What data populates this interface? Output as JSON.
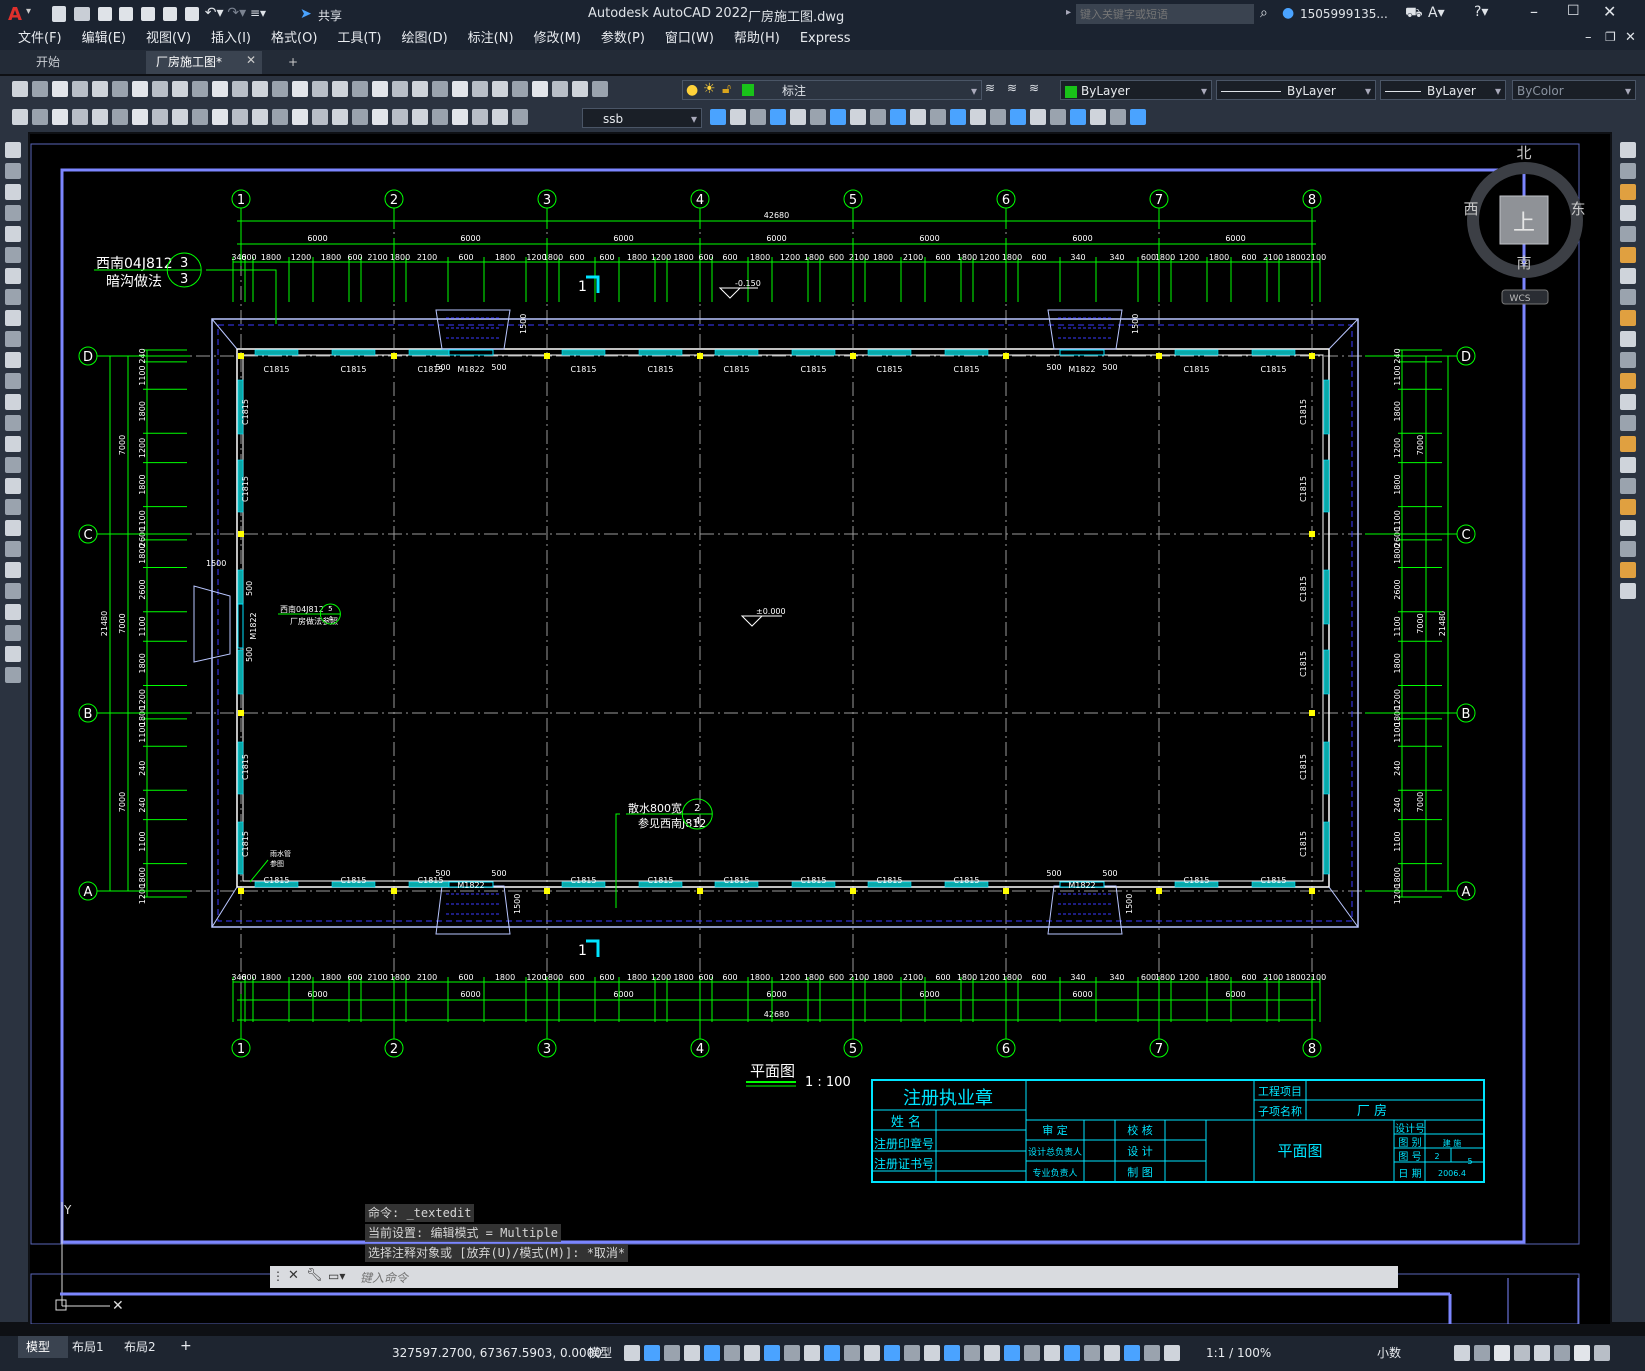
{
  "app": {
    "title": "Autodesk AutoCAD 2022",
    "filename": "厂房施工图.dwg",
    "share_label": "共享",
    "search_placeholder": "键入关键字或短语",
    "user": "1505999135...",
    "logo": "A"
  },
  "menu": [
    "文件(F)",
    "编辑(E)",
    "视图(V)",
    "插入(I)",
    "格式(O)",
    "工具(T)",
    "绘图(D)",
    "标注(N)",
    "修改(M)",
    "参数(P)",
    "窗口(W)",
    "帮助(H)",
    "Express"
  ],
  "tabs": {
    "start": "开始",
    "drawing": "厂房施工图*",
    "add": "+"
  },
  "toolbar": {
    "layer_name": "标注",
    "color": "ByLayer",
    "linetype": "ByLayer",
    "lineweight": "ByLayer",
    "plotstyle": "ByColor",
    "textstyle": "ssb"
  },
  "viewcube": {
    "north": "北",
    "south": "南",
    "east": "东",
    "west": "西",
    "top": "上",
    "wcs": "WCS"
  },
  "drawing": {
    "grid_cols": [
      "1",
      "2",
      "3",
      "4",
      "5",
      "6",
      "7",
      "8"
    ],
    "grid_rows": [
      "D",
      "C",
      "B",
      "A"
    ],
    "total_width": "42680",
    "total_height": "21480",
    "bay": "6000",
    "bay_7000": "7000",
    "top_sub": [
      "340",
      "600",
      "1800",
      "1200",
      "1800",
      "600",
      "2100",
      "1800",
      "2100",
      "600",
      "1800",
      "1200",
      "1800",
      "600",
      "600",
      "1800",
      "1200",
      "1800",
      "600",
      "600",
      "1800",
      "1200",
      "1800",
      "600",
      "2100",
      "1800",
      "2100",
      "600",
      "1800",
      "1200",
      "1800",
      "600",
      "340"
    ],
    "side_sub": [
      "240",
      "1100",
      "1800",
      "1200",
      "1800",
      "1100",
      "2600",
      "1800",
      "2600",
      "1100",
      "1800",
      "1200",
      "1800",
      "1100",
      "240"
    ],
    "window": "C1815",
    "door": "M1822",
    "dim_500": "500",
    "dim_1500": "1500",
    "level_top": "-0.150",
    "level_floor": "±0.000",
    "section_mark": "1",
    "note_drain_1": "西南04J812",
    "note_drain_2": "暗沟做法",
    "note_drain_num_top": "3",
    "note_drain_num_bot": "3",
    "note_ramp_1": "西南04J812",
    "note_ramp_2": "厂房做法参照",
    "note_ramp_top": "5",
    "note_ramp_bot": "4",
    "note_apron_1": "散水800宽",
    "note_apron_2": "参见西南J812",
    "note_apron_top": "2",
    "note_apron_bot": "4",
    "note_pipe_1": "雨水管",
    "note_pipe_2": "参图",
    "plan_title": "平面图",
    "plan_scale": "1 : 100"
  },
  "titleblock": {
    "stamp": "注册执业章",
    "name": "姓  名",
    "stamp_no": "注册印章号",
    "cert_no": "注册证书号",
    "project": "工程项目",
    "subproject": "子项名称",
    "subproject_val": "厂    房",
    "approve": "审  定",
    "check": "校  核",
    "design_lead": "设计总负责人",
    "design": "设  计",
    "discipline_lead": "专业负责人",
    "draw": "制  图",
    "sheet_title": "平面图",
    "design_no": "设计号",
    "category": "图  别",
    "category_val": "建 施",
    "sheet_no": "图  号",
    "sheet_no_val": "2",
    "sheet_total": "5",
    "date": "日  期",
    "date_val": "2006.4"
  },
  "command": {
    "line1": "命令: _textedit",
    "line2": "当前设置: 编辑模式 = Multiple",
    "line3": "选择注释对象或 [放弃(U)/模式(M)]: *取消*",
    "prompt_placeholder": "键入命令"
  },
  "status": {
    "layout_tabs": [
      "模型",
      "布局1",
      "布局2"
    ],
    "add_tab": "+",
    "coords": "327597.2700, 67367.5903, 0.0000",
    "space": "模型",
    "scale": "1:1 / 100%",
    "units": "小数"
  }
}
